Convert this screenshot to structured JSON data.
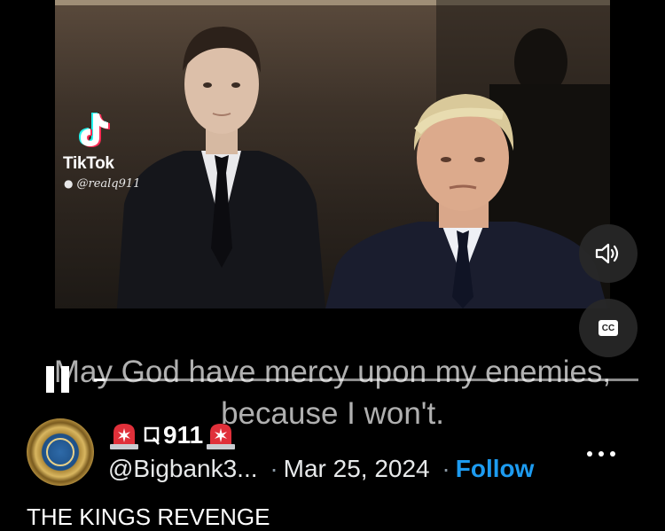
{
  "video": {
    "watermark_brand": "TikTok",
    "watermark_user": "@realq911",
    "caption_line1": "May God have mercy upon my enemies,",
    "caption_line2": "because I won't.",
    "progress_fraction": 0.02,
    "controls": {
      "pause": "pause-icon",
      "volume": "speaker-icon",
      "cc": "CC"
    }
  },
  "author": {
    "display_name": "🇶911",
    "display_name_text": "911",
    "handle": "@Bigbank3...",
    "separator": "·",
    "date": "Mar 25, 2024",
    "follow_label": "Follow",
    "more_icon": "more-icon"
  },
  "tweet": {
    "text": "THE KINGS REVENGE"
  },
  "colors": {
    "accent": "#1d9bf0",
    "background": "#000000",
    "secondary_text": "#8b98a5",
    "siren_red": "#e0303a"
  }
}
